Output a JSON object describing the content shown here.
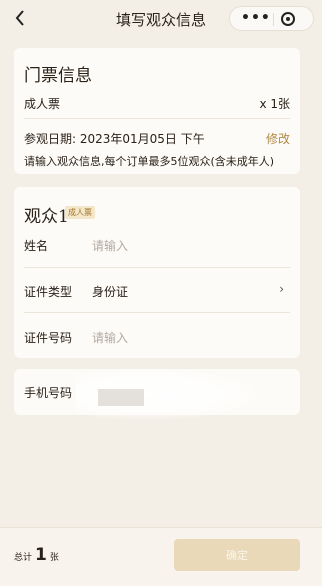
{
  "nav": {
    "title": "填写观众信息",
    "more": "•••"
  },
  "ticket": {
    "title": "门票信息",
    "type": "成人票",
    "qty": "x 1张",
    "date_label": "参观日期:  2023年01月05日   下午",
    "edit": "修改",
    "note": "请输入观众信息,每个订单最多5位观众(含未成年人)"
  },
  "visitor": {
    "title": "观众1",
    "badge": "成人票",
    "name_label": "姓名",
    "name_placeholder": "请输入",
    "id_type_label": "证件类型",
    "id_type_value": "身份证",
    "id_no_label": "证件号码",
    "id_no_placeholder": "请输入",
    "chevron": "›"
  },
  "phone": {
    "label": "手机号码"
  },
  "footer": {
    "total_prefix": "总计",
    "total_num": "1",
    "total_unit": "张",
    "confirm": "确定"
  }
}
